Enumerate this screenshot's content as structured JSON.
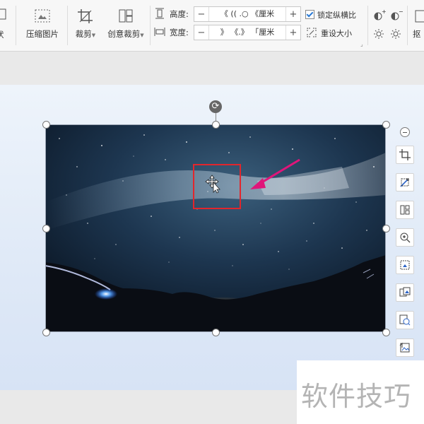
{
  "ribbon": {
    "partial_left_label": "状",
    "compress_label": "压缩图片",
    "crop_label": "裁剪",
    "creative_crop_label": "创意裁剪",
    "height_label": "高度:",
    "height_value": "《 (( .○ 《厘米",
    "width_label": "宽度:",
    "width_value": "》 《.》 「厘米",
    "minus": "−",
    "plus": "+",
    "lock_ratio_label": "锁定纵横比",
    "reset_size_label": "重设大小",
    "partial_right_label": "抠"
  },
  "canvas": {
    "image_desc": "starry-sky-milky-way-photo",
    "highlight_color": "#e2262c",
    "arrow_color": "#e0157a"
  },
  "watermark": "软件技巧"
}
